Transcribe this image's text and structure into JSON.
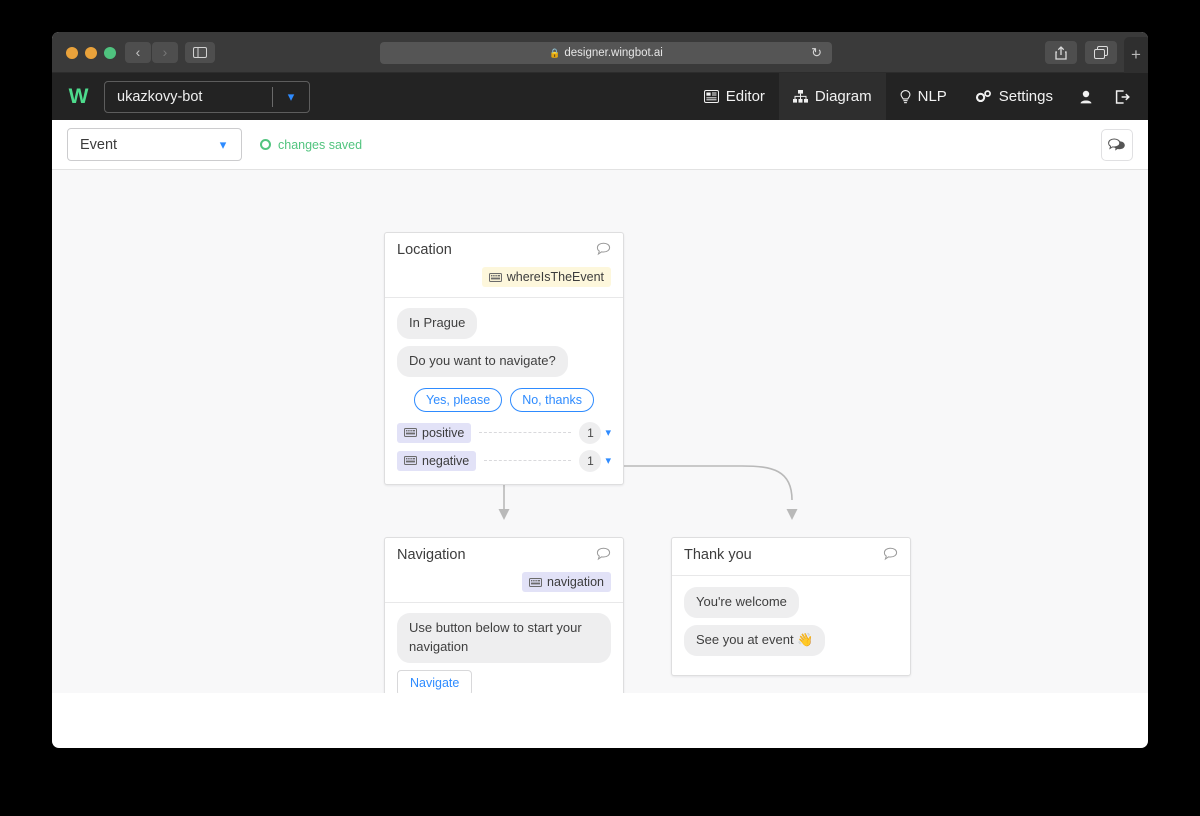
{
  "browser": {
    "url": "designer.wingbot.ai",
    "lock_icon": "lock-icon",
    "reload_icon": "reload-icon",
    "back_icon": "chevron-left-icon",
    "forward_icon": "chevron-right-icon",
    "sidebar_icon": "sidebar-toggle-icon",
    "share_icon": "share-icon",
    "tabs_icon": "tabs-overview-icon",
    "newtab_label": "+"
  },
  "app": {
    "brand": "W",
    "bot_name": "ukazkovy-bot",
    "bot_caret": "chevron-down-icon",
    "nav": [
      {
        "label": "Editor",
        "icon": "editor-icon",
        "active": false
      },
      {
        "label": "Diagram",
        "icon": "diagram-icon",
        "active": true
      },
      {
        "label": "NLP",
        "icon": "bulb-icon",
        "active": false
      },
      {
        "label": "Settings",
        "icon": "gears-icon",
        "active": false
      }
    ],
    "user_icon": "user-icon",
    "logout_icon": "logout-icon"
  },
  "toolbar": {
    "event_select_value": "Event",
    "event_caret": "chevron-down-icon",
    "save_status": "changes saved",
    "save_status_color": "#52c47f",
    "chat_icon": "chat-bubbles-icon"
  },
  "canvas": {
    "background": "#f8f8f9",
    "nodes": [
      {
        "id": "location",
        "title": "Location",
        "bubble_icon": "speech-bubble-icon",
        "tag": {
          "label": "whereIsTheEvent",
          "icon": "keyboard-icon",
          "color": "yellow"
        },
        "messages": [
          "In Prague",
          "Do you want to navigate?"
        ],
        "quick_replies": [
          "Yes, please",
          "No, thanks"
        ],
        "intents": [
          {
            "label": "positive",
            "icon": "keyboard-icon",
            "count": "1",
            "caret": "chevron-down-icon"
          },
          {
            "label": "negative",
            "icon": "keyboard-icon",
            "count": "1",
            "caret": "chevron-down-icon"
          }
        ]
      },
      {
        "id": "navigation",
        "title": "Navigation",
        "bubble_icon": "speech-bubble-icon",
        "tag": {
          "label": "navigation",
          "icon": "keyboard-icon",
          "color": "violet"
        },
        "messages": [
          "Use button below to start your navigation"
        ],
        "button": "Navigate"
      },
      {
        "id": "thankyou",
        "title": "Thank you",
        "bubble_icon": "speech-bubble-icon",
        "messages": [
          "You're welcome",
          "See you at event 👋"
        ]
      }
    ]
  },
  "colors": {
    "accent_blue": "#2e8bff",
    "brand_green": "#4ddb8c",
    "nav_dark": "#232323",
    "tag_yellow": "#fdf7dc",
    "tag_violet": "#e2e2f7"
  }
}
